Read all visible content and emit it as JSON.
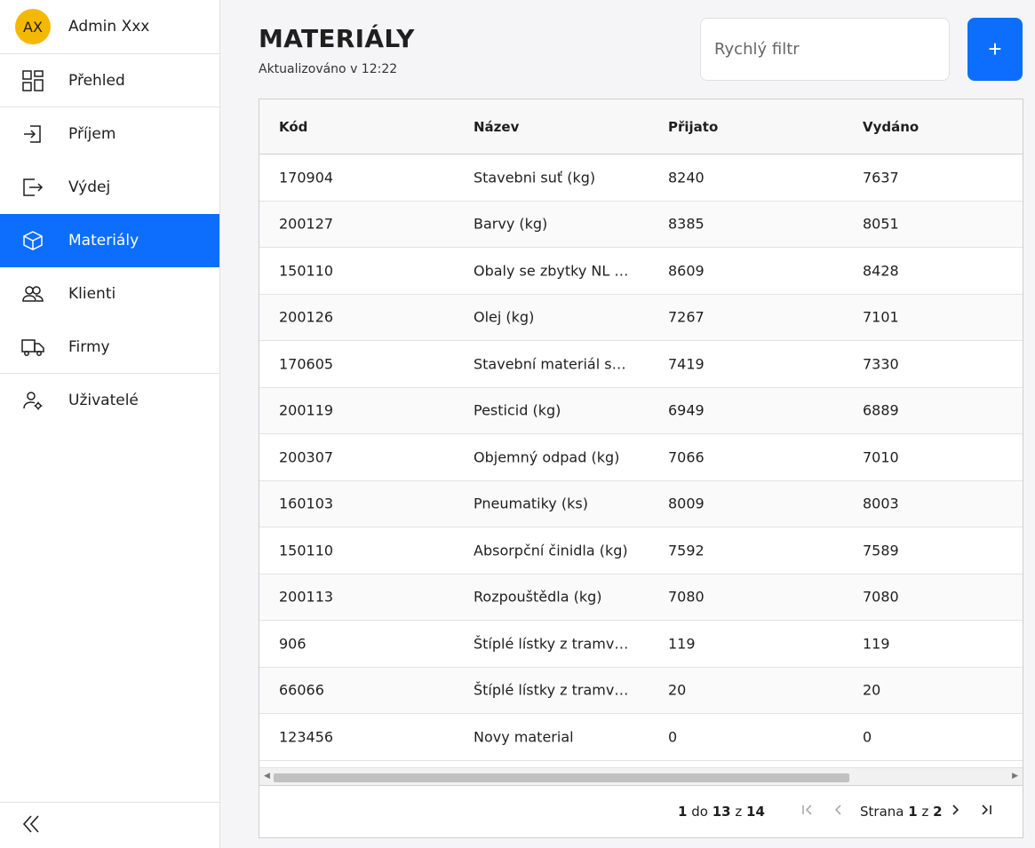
{
  "user": {
    "initials": "AX",
    "name": "Admin Xxx"
  },
  "nav": {
    "items": [
      {
        "label": "Přehled",
        "icon": "dashboard-icon"
      },
      {
        "label": "Příjem",
        "icon": "login-icon"
      },
      {
        "label": "Výdej",
        "icon": "logout-icon"
      },
      {
        "label": "Materiály",
        "icon": "box-icon"
      },
      {
        "label": "Klienti",
        "icon": "users-icon"
      },
      {
        "label": "Firmy",
        "icon": "truck-icon"
      },
      {
        "label": "Uživatelé",
        "icon": "user-settings-icon"
      }
    ]
  },
  "page": {
    "title": "MATERIÁLY",
    "updated": "Aktualizováno v 12:22"
  },
  "filter": {
    "placeholder": "Rychlý filtr"
  },
  "add_button": {
    "label": "+"
  },
  "table": {
    "columns": [
      "Kód",
      "Název",
      "Přijato",
      "Vydáno"
    ],
    "rows": [
      [
        "170904",
        "Stavebni suť (kg)",
        "8240",
        "7637"
      ],
      [
        "200127",
        "Barvy (kg)",
        "8385",
        "8051"
      ],
      [
        "150110",
        "Obaly se zbytky NL (...",
        "8609",
        "8428"
      ],
      [
        "200126",
        "Olej (kg)",
        "7267",
        "7101"
      ],
      [
        "170605",
        "Stavební materiál s ...",
        "7419",
        "7330"
      ],
      [
        "200119",
        "Pesticid (kg)",
        "6949",
        "6889"
      ],
      [
        "200307",
        "Objemný odpad (kg)",
        "7066",
        "7010"
      ],
      [
        "160103",
        "Pneumatiky (ks)",
        "8009",
        "8003"
      ],
      [
        "150110",
        "Absorpční činidla (kg)",
        "7592",
        "7589"
      ],
      [
        "200113",
        "Rozpouštědla (kg)",
        "7080",
        "7080"
      ],
      [
        "906",
        "Štíplé lístky z tramvaje",
        "119",
        "119"
      ],
      [
        "66066",
        "Štíplé lístky z tramvaje",
        "20",
        "20"
      ],
      [
        "123456",
        "Novy material",
        "0",
        "0"
      ]
    ]
  },
  "pager": {
    "from": "1",
    "to": "13",
    "total": "14",
    "word_to": "do",
    "word_of": "z",
    "page_word": "Strana",
    "page": "1",
    "pages": "2"
  },
  "colors": {
    "accent": "#0d6efd",
    "avatar": "#f5b800"
  }
}
